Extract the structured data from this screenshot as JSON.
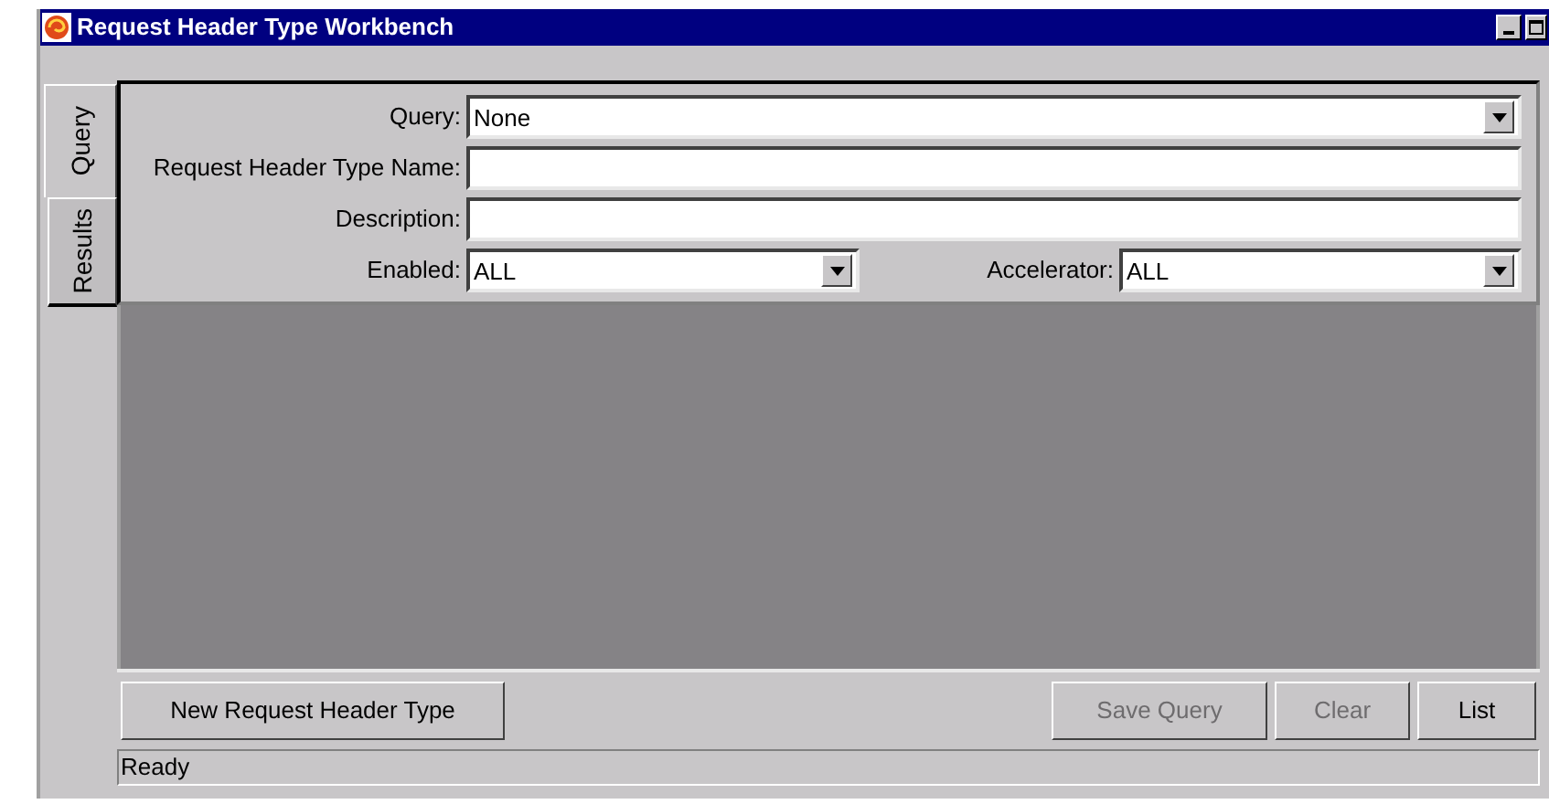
{
  "window": {
    "title": "Request Header Type Workbench"
  },
  "tabs": [
    {
      "label": "Query",
      "selected": true
    },
    {
      "label": "Results",
      "selected": false
    }
  ],
  "fields": [
    {
      "label": "Query:",
      "kind": "dropdown",
      "value": "None"
    },
    {
      "label": "Request Header Type Name:",
      "kind": "text"
    },
    {
      "label": "Description:",
      "kind": "text"
    }
  ],
  "row_fields": [
    {
      "label": "Enabled:",
      "kind": "dropdown",
      "value": "ALL"
    },
    {
      "label": "Accelerator:",
      "kind": "dropdown",
      "value": "ALL"
    }
  ],
  "buttons": [
    {
      "label": "New Request Header Type",
      "disabled": false
    },
    {
      "label": "Save Query",
      "disabled": true
    },
    {
      "label": "Clear",
      "disabled": true
    },
    {
      "label": "List",
      "disabled": false
    }
  ],
  "status_bar": "Ready"
}
